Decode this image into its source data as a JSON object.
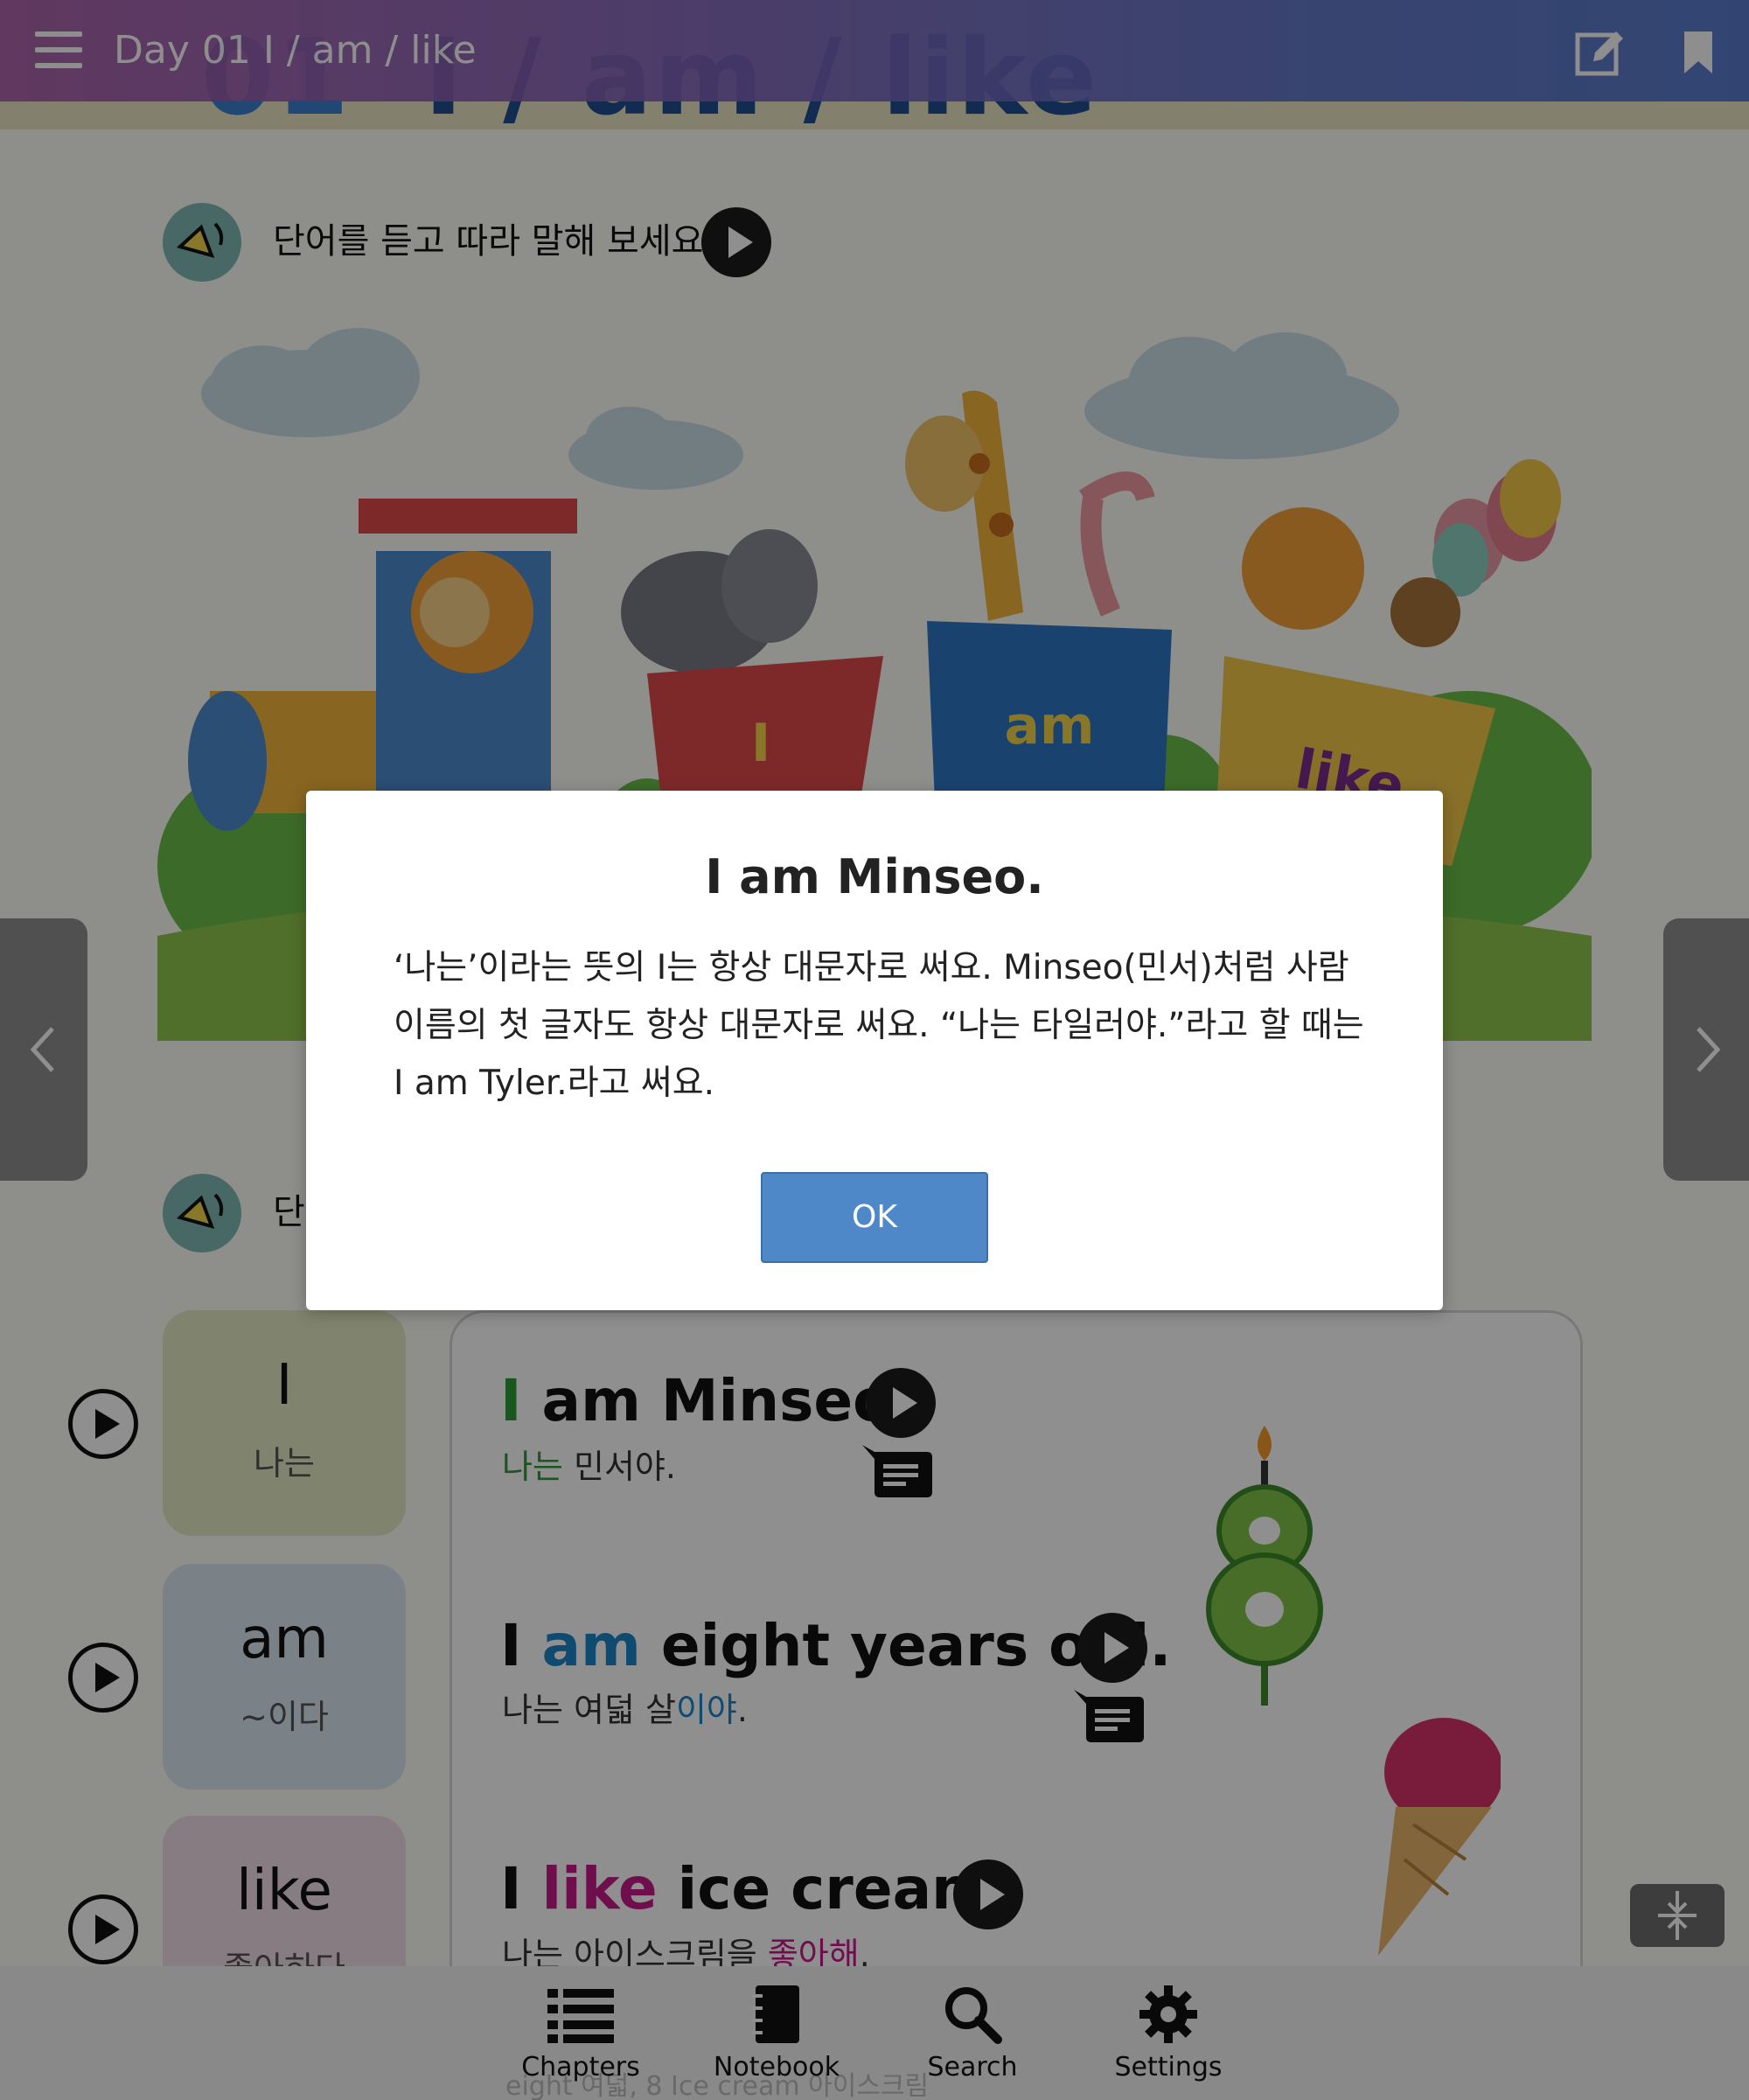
{
  "header": {
    "title": "Day 01 I / am / like",
    "lesson_number": "01",
    "lesson_words": "I / am / like",
    "day_tag": "Day"
  },
  "section1": {
    "instruction": "단어를 듣고 따라 말해 보세요."
  },
  "illustration": {
    "cart_words": [
      "I",
      "am",
      "like"
    ]
  },
  "section2": {
    "instruction_partial": "단"
  },
  "words": [
    {
      "word": "I",
      "meaning": "나는",
      "color": "#e5ecc6"
    },
    {
      "word": "am",
      "meaning": "~이다",
      "color": "#d9e7f1"
    },
    {
      "word": "like",
      "meaning": "좋아하다",
      "color": "#f1dde6"
    }
  ],
  "sentences": [
    {
      "parts": [
        {
          "t": "I",
          "c": "g"
        },
        {
          "t": " am Minseo.",
          "c": ""
        }
      ],
      "translation": [
        {
          "t": "나는",
          "c": "g"
        },
        {
          "t": " 민서야.",
          "c": ""
        }
      ]
    },
    {
      "parts": [
        {
          "t": "I ",
          "c": ""
        },
        {
          "t": "am",
          "c": "b"
        },
        {
          "t": " eight years old.",
          "c": ""
        }
      ],
      "translation": [
        {
          "t": "나는 여덟 살",
          "c": ""
        },
        {
          "t": "이야",
          "c": "b"
        },
        {
          "t": ".",
          "c": ""
        }
      ]
    },
    {
      "parts": [
        {
          "t": "I ",
          "c": ""
        },
        {
          "t": "like",
          "c": "p"
        },
        {
          "t": " ice cream.",
          "c": ""
        }
      ],
      "translation": [
        {
          "t": "나는 아이스크림을 ",
          "c": ""
        },
        {
          "t": "좋아해",
          "c": "p"
        },
        {
          "t": ".",
          "c": ""
        }
      ]
    }
  ],
  "bottom_nav": {
    "items": [
      {
        "label": "Chapters",
        "icon": "list-icon"
      },
      {
        "label": "Notebook",
        "icon": "notebook-icon"
      },
      {
        "label": "Search",
        "icon": "search-icon"
      },
      {
        "label": "Settings",
        "icon": "gear-icon"
      }
    ],
    "ghost_text": "eight 여덟, 8  Ice cream 아이스크림"
  },
  "dialog": {
    "title": "I am Minseo.",
    "body_lines": [
      "‘나는’이라는 뜻의 I는 항상 대문자로 써요. Minseo(민서)처럼 사람",
      "이름의 첫 글자도 항상 대문자로 써요. “나는 타일러야.”라고 할 때는",
      "I am Tyler.라고 써요."
    ],
    "ok_label": "OK"
  },
  "colors": {
    "header_gradient_start": "#a65aa6",
    "header_gradient_end": "#4e73c9",
    "ok_button": "#4f88c8",
    "highlight_green": "#2e9a3a",
    "highlight_blue": "#1c86c8",
    "highlight_pink": "#c71a8a"
  }
}
